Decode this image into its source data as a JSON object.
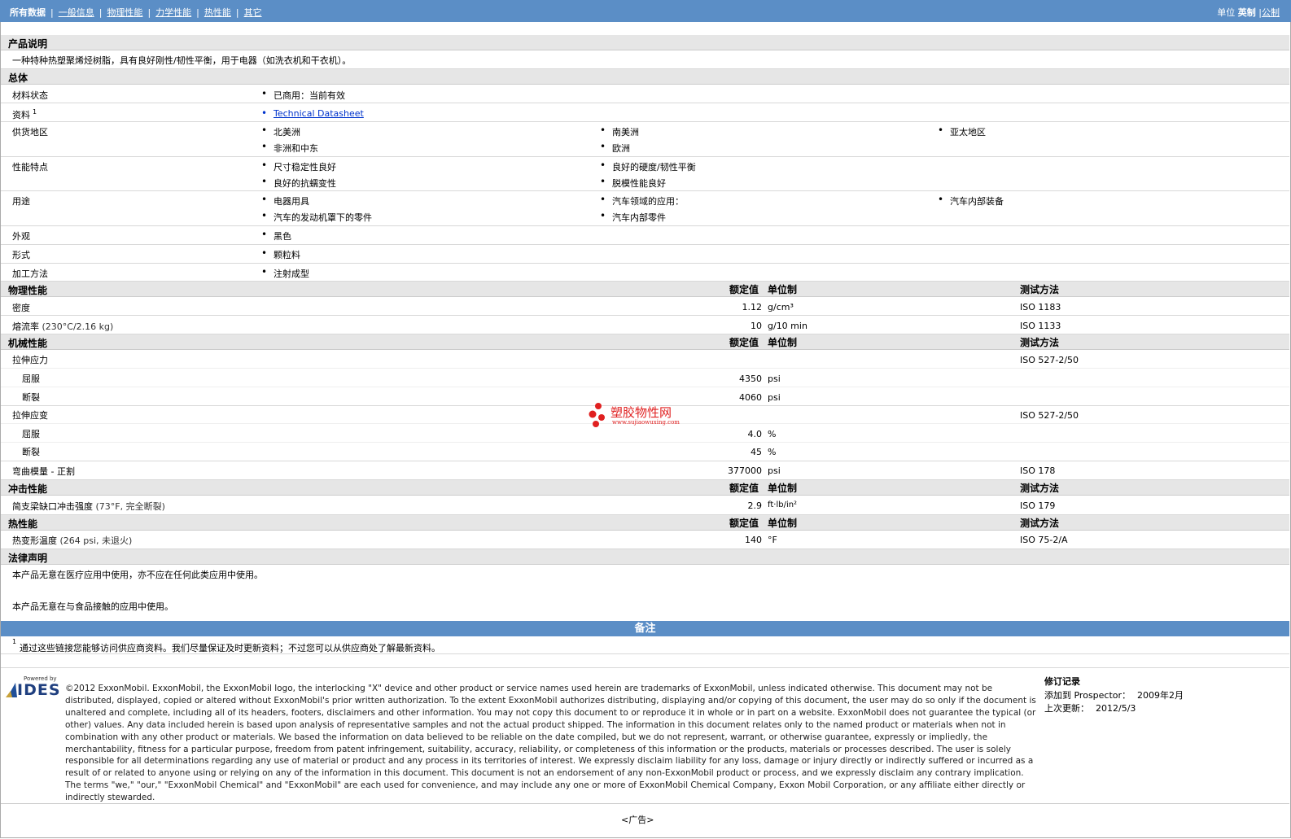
{
  "nav": {
    "tabs": [
      "所有数据",
      "一般信息",
      "物理性能",
      "力学性能",
      "热性能",
      "其它"
    ],
    "units_label": "单位",
    "units_current": "英制",
    "units_other": "公制"
  },
  "sections": {
    "product_desc": {
      "title": "产品说明",
      "text": "一种特种热塑聚烯烃树脂，具有良好刚性/韧性平衡，用于电器（如洗衣机和干衣机）。"
    },
    "general": {
      "title": "总体",
      "rows": [
        {
          "label": "材料状态",
          "values": [
            "已商用：当前有效"
          ]
        },
        {
          "label": "资料",
          "sup": "1",
          "values": [
            "Technical Datasheet"
          ]
        },
        {
          "label": "供货地区",
          "values": [
            "北美洲",
            "南美洲",
            "亚太地区",
            "非洲和中东",
            "欧洲"
          ]
        },
        {
          "label": "性能特点",
          "values": [
            "尺寸稳定性良好",
            "良好的硬度/韧性平衡",
            "良好的抗蠕变性",
            "脱模性能良好"
          ]
        },
        {
          "label": "用途",
          "values": [
            "电器用具",
            "汽车领域的应用：",
            "汽车内部装备",
            "汽车的发动机罩下的零件",
            "汽车内部零件"
          ]
        },
        {
          "label": "外观",
          "values": [
            "黑色"
          ]
        },
        {
          "label": "形式",
          "values": [
            "颗粒料"
          ]
        },
        {
          "label": "加工方法",
          "values": [
            "注射成型"
          ]
        }
      ]
    },
    "col_headers": {
      "nominal": "额定值",
      "unit": "单位制",
      "method": "测试方法"
    },
    "physical": {
      "title": "物理性能",
      "rows": [
        {
          "label": "密度",
          "cond": "",
          "value": "1.12",
          "unit": "g/cm³",
          "method": "ISO 1183"
        },
        {
          "label": "熔流率",
          "cond": "(230°C/2.16 kg)",
          "value": "10",
          "unit": "g/10 min",
          "method": "ISO 1133"
        }
      ]
    },
    "mechanical": {
      "title": "机械性能",
      "rows": [
        {
          "label": "拉伸应力",
          "value": "",
          "unit": "",
          "method": "ISO 527-2/50"
        },
        {
          "label": "屈服",
          "value": "4350",
          "unit": "psi",
          "method": ""
        },
        {
          "label": "断裂",
          "value": "4060",
          "unit": "psi",
          "method": ""
        },
        {
          "label": "拉伸应变",
          "value": "",
          "unit": "",
          "method": "ISO 527-2/50"
        },
        {
          "label": "屈服",
          "value": "4.0",
          "unit": "%",
          "method": ""
        },
        {
          "label": "断裂",
          "value": "45",
          "unit": "%",
          "method": ""
        },
        {
          "label": "弯曲模量 - 正割",
          "value": "377000",
          "unit": "psi",
          "method": "ISO 178"
        }
      ]
    },
    "impact": {
      "title": "冲击性能",
      "rows": [
        {
          "label": "简支梁缺口冲击强度",
          "cond": "(73°F, 完全断裂)",
          "value": "2.9",
          "unit": "ft·lb/in²",
          "method": "ISO 179"
        }
      ]
    },
    "thermal": {
      "title": "热性能",
      "rows": [
        {
          "label": "热变形温度",
          "cond": "(264 psi, 未退火)",
          "value": "140",
          "unit": "°F",
          "method": "ISO 75-2/A"
        }
      ]
    },
    "legal": {
      "title": "法律声明",
      "lines": [
        "本产品无意在医疗应用中使用，亦不应在任何此类应用中使用。",
        "本产品无意在与食品接触的应用中使用。"
      ]
    }
  },
  "notes": {
    "title": "备注",
    "sup": "1",
    "text": "通过这些链接您能够访问供应商资料。我们尽量保证及时更新资料；不过您可以从供应商处了解最新资料。"
  },
  "watermark": {
    "title": "塑胶物性网",
    "url": "www.sujiaowuxing.com"
  },
  "logo": {
    "top": "Powered by",
    "brand": "IDES"
  },
  "footer": {
    "copyright": "©2012 ExxonMobil. ExxonMobil, the ExxonMobil logo, the interlocking \"X\" device and other product or service names used herein are trademarks of ExxonMobil, unless indicated otherwise. This document may not be distributed, displayed, copied or altered without ExxonMobil's prior written authorization. To the extent ExxonMobil authorizes distributing, displaying and/or copying of this document, the user may do so only if the document is unaltered and complete, including all of its headers, footers, disclaimers and other information. You may not copy this document to or reproduce it in whole or in part on a website. ExxonMobil does not guarantee the typical (or other) values. Any data included herein is based upon analysis of representative samples and not the actual product shipped. The information in this document relates only to the named product or materials when not in combination with any other product or materials. We based the information on data believed to be reliable on the date compiled, but we do not represent, warrant, or otherwise guarantee, expressly or impliedly, the merchantability, fitness for a particular purpose, freedom from patent infringement, suitability, accuracy, reliability, or completeness of this information or the products, materials or processes described. The user is solely responsible for all determinations regarding any use of material or product and any process in its territories of interest. We expressly disclaim liability for any loss, damage or injury directly or indirectly suffered or incurred as a result of or related to anyone using or relying on any of the information in this document. This document is not an endorsement of any non-ExxonMobil product or process, and we expressly disclaim any contrary implication. The terms \"we,\" \"our,\" \"ExxonMobil Chemical\" and \"ExxonMobil\" are each used for convenience, and may include any one or more of ExxonMobil Chemical Company, Exxon Mobil Corporation, or any affiliate either directly or indirectly stewarded.",
    "revision_title": "修订记录",
    "added_label": "添加到 Prospector：",
    "added_value": "2009年2月",
    "updated_label": "上次更新：",
    "updated_value": "2012/5/3",
    "ad": "<广告>"
  }
}
